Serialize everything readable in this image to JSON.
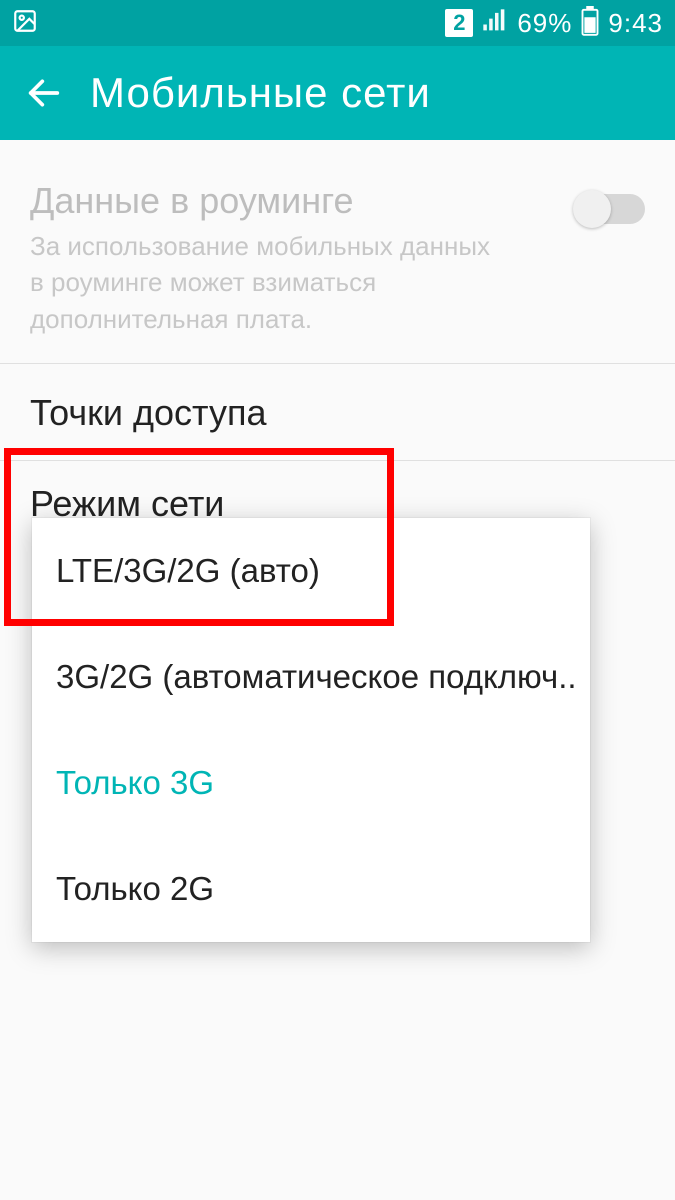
{
  "status": {
    "sim_badge": "2",
    "battery_pct": "69%",
    "time": "9:43"
  },
  "appbar": {
    "title": "Мобильные сети"
  },
  "roaming": {
    "title": "Данные в роуминге",
    "desc": "За использование мобильных данных в роуминге может взиматься дополнительная плата.",
    "enabled": false
  },
  "apn": {
    "title": "Точки доступа"
  },
  "network_mode": {
    "title": "Режим сети",
    "options": [
      {
        "label": "LTE/3G/2G (авто)",
        "selected": false
      },
      {
        "label": "3G/2G (автоматическое подключ..",
        "selected": false
      },
      {
        "label": "Только 3G",
        "selected": true
      },
      {
        "label": "Только 2G",
        "selected": false
      }
    ]
  },
  "colors": {
    "accent": "#00b5b5",
    "status_bar": "#00a2a2",
    "highlight": "#ff0000"
  }
}
